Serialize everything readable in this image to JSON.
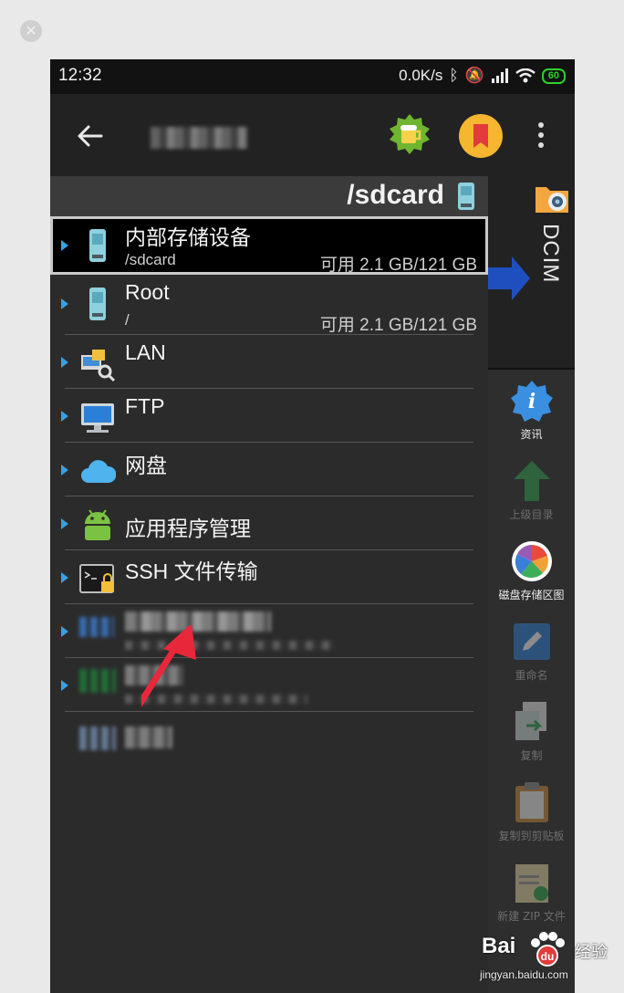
{
  "status_bar": {
    "time": "12:32",
    "net_speed": "0.0K/s",
    "battery": "60"
  },
  "path_bar": {
    "path": "/sdcard"
  },
  "dcim_panel": {
    "label": "DCIM"
  },
  "storage_list": [
    {
      "name": "内部存储设备",
      "subtitle": "/sdcard",
      "capacity": "可用 2.1 GB/121 GB",
      "icon": "sdcard-icon"
    },
    {
      "name": "Root",
      "subtitle": "/",
      "capacity": "可用 2.1 GB/121 GB",
      "icon": "sdcard-icon"
    },
    {
      "name": "LAN",
      "icon": "lan-icon"
    },
    {
      "name": "FTP",
      "icon": "monitor-icon"
    },
    {
      "name": "网盘",
      "icon": "cloud-icon"
    },
    {
      "name": "应用程序管理",
      "icon": "android-icon"
    },
    {
      "name": "SSH 文件传输",
      "icon": "terminal-lock-icon"
    }
  ],
  "side_actions": [
    {
      "label": "资讯",
      "icon": "info-icon",
      "enabled": true
    },
    {
      "label": "上级目录",
      "icon": "up-arrow-icon",
      "enabled": false
    },
    {
      "label": "磁盘存储区图",
      "icon": "pie-chart-icon",
      "enabled": true
    },
    {
      "label": "重命名",
      "icon": "rename-icon",
      "enabled": false
    },
    {
      "label": "复制",
      "icon": "copy-icon",
      "enabled": false
    },
    {
      "label": "复制到剪贴板",
      "icon": "clipboard-icon",
      "enabled": false
    },
    {
      "label": "新建 ZIP 文件",
      "icon": "zip-icon",
      "enabled": false
    }
  ],
  "watermark": {
    "brand": "Bai",
    "brand_suffix": "经验",
    "url": "jingyan.baidu.com"
  },
  "colors": {
    "accent_chevron": "#3aa0e0",
    "battery_green": "#2bd22b",
    "arrow_red": "#e8283a"
  }
}
